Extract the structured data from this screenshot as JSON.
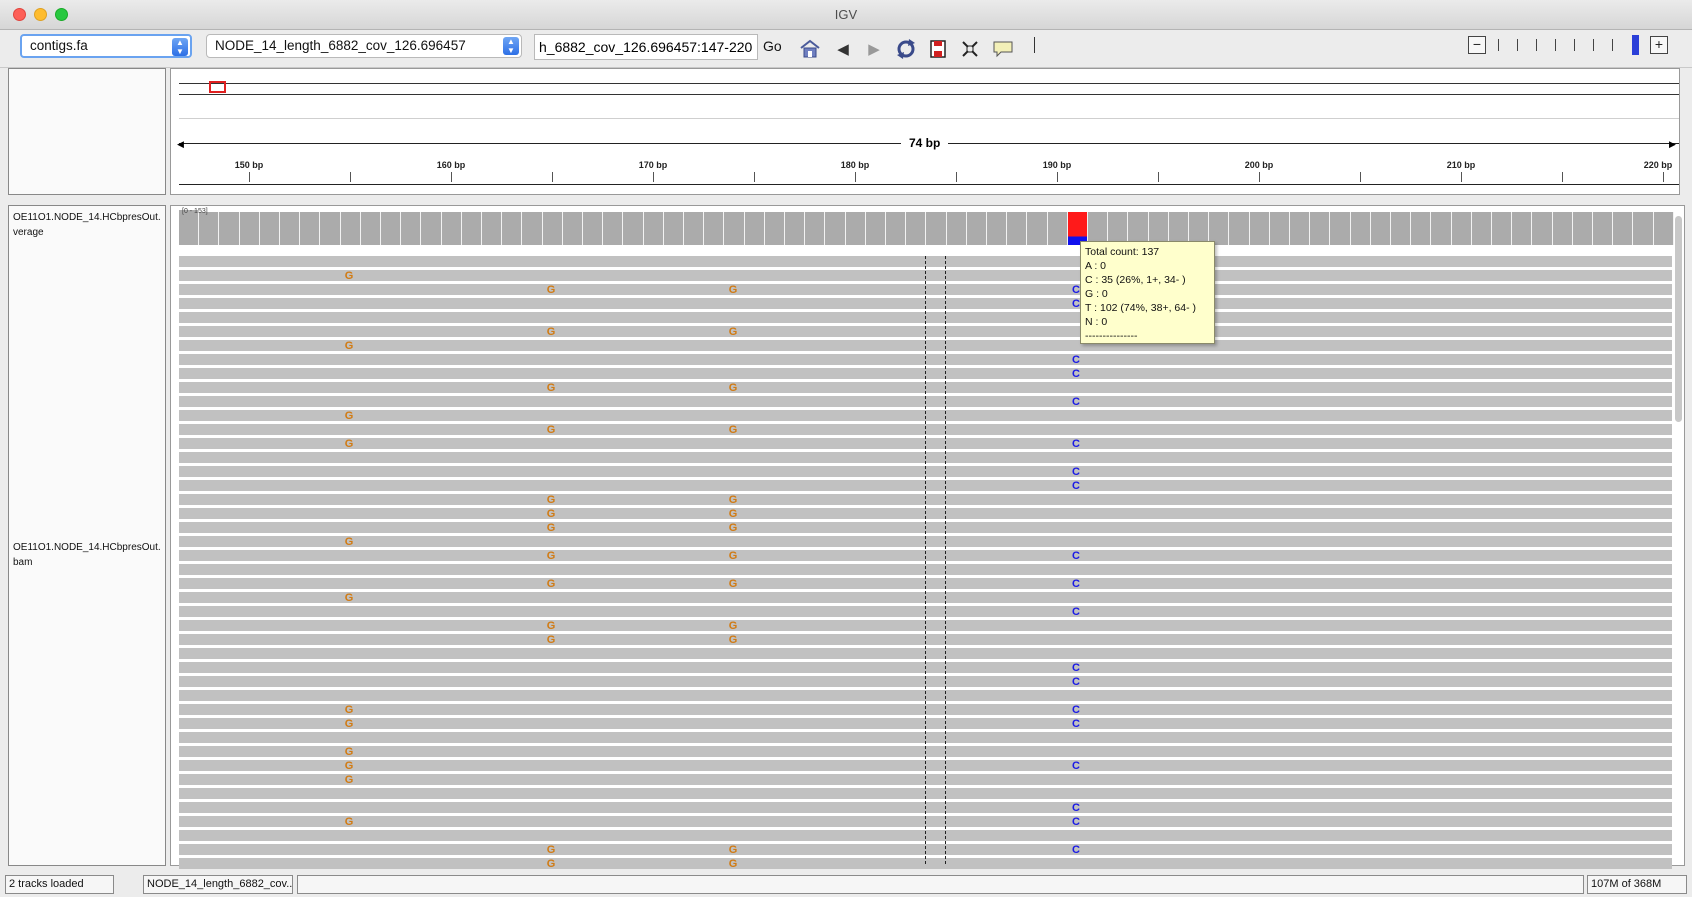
{
  "window": {
    "title": "IGV"
  },
  "toolbar": {
    "genome_value": "contigs.fa",
    "chromosome_value": "NODE_14_length_6882_cov_126.696457",
    "locus_value": "h_6882_cov_126.696457:147-220",
    "go_label": "Go",
    "icons": [
      "home-icon",
      "back-icon",
      "forward-icon",
      "refresh-icon",
      "roi-icon",
      "fit-window-icon",
      "popup-info-icon",
      "divider-icon"
    ],
    "zoom_out_label": "−",
    "zoom_in_label": "+"
  },
  "ruler": {
    "span_label": "74 bp",
    "ticks": [
      "150 bp",
      "160 bp",
      "170 bp",
      "180 bp",
      "190 bp",
      "200 bp",
      "210 bp",
      "220 bp"
    ],
    "ideogram_marker_color": "#e02020"
  },
  "tracks": {
    "coverage": {
      "name_line1": "OE11O1.NODE_14.HCbpresOut.",
      "name_line2": "verage",
      "data_range": "[0 - 153]",
      "bar_color": "#ababab",
      "mismatch_colors": {
        "T": "#ff1a1a",
        "C": "#1010ee"
      }
    },
    "alignment": {
      "name_line1": "OE11O1.NODE_14.HCbpresOut.",
      "name_line2": "bam",
      "read_color": "#c1c1c1",
      "base_colors": {
        "G": "#d17a12",
        "C": "#1a1ae6"
      }
    }
  },
  "tooltip": {
    "lines": [
      "Total count: 137",
      "A : 0",
      "C : 35 (26%, 1+, 34- )",
      "G : 0",
      "T : 102 (74%, 38+, 64- )",
      "N : 0",
      "---------------"
    ]
  },
  "status": {
    "tracks_loaded": "2 tracks loaded",
    "locus": "NODE_14_length_6882_cov...",
    "message": "",
    "memory": "107M of 368M"
  }
}
